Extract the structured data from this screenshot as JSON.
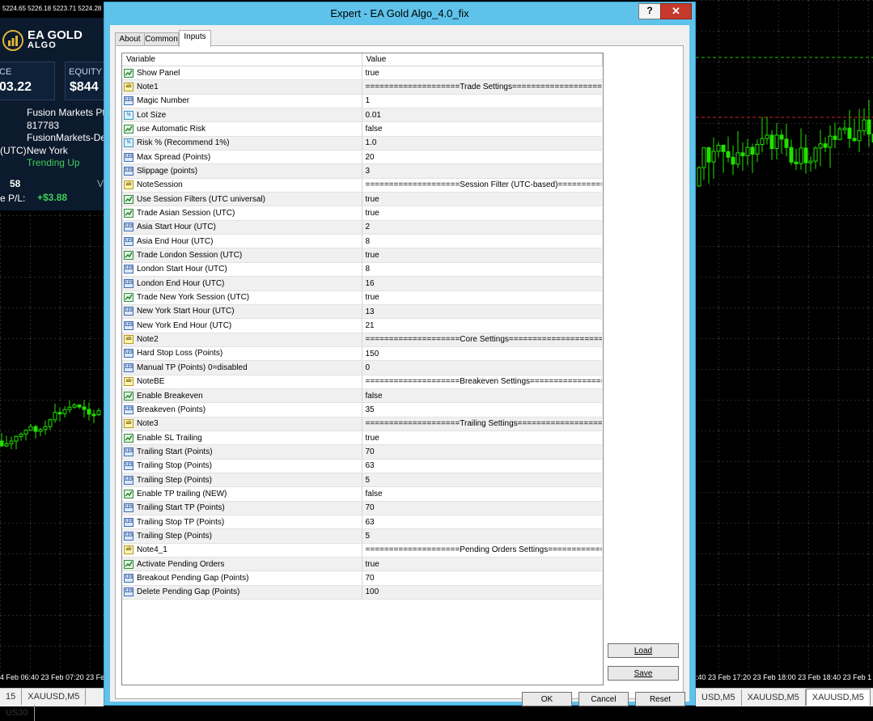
{
  "window": {
    "title": "Expert - EA Gold Algo_4.0_fix",
    "help_label": "?",
    "close_label": "✕"
  },
  "tabs": [
    {
      "label": "About"
    },
    {
      "label": "Common"
    },
    {
      "label": "Inputs"
    }
  ],
  "table": {
    "headers": {
      "variable": "Variable",
      "value": "Value"
    },
    "rows": [
      {
        "type": "bool",
        "name": "Show Panel",
        "value": "true"
      },
      {
        "type": "string",
        "name": "Note1",
        "value": "====================Trade Settings===================="
      },
      {
        "type": "int",
        "name": "Magic Number",
        "value": "1"
      },
      {
        "type": "double",
        "name": "Lot Size",
        "value": "0.01"
      },
      {
        "type": "bool",
        "name": "use Automatic Risk",
        "value": "false"
      },
      {
        "type": "double",
        "name": "Risk % (Recommend 1%)",
        "value": "1.0"
      },
      {
        "type": "int",
        "name": "Max Spread (Points)",
        "value": "20"
      },
      {
        "type": "int",
        "name": "Slippage (points)",
        "value": "3"
      },
      {
        "type": "string",
        "name": "NoteSession",
        "value": "====================Session Filter (UTC-based)==============..."
      },
      {
        "type": "bool",
        "name": "Use Session Filters (UTC universal)",
        "value": "true"
      },
      {
        "type": "bool",
        "name": "Trade Asian Session (UTC)",
        "value": "true"
      },
      {
        "type": "int",
        "name": "Asia Start Hour (UTC)",
        "value": "2"
      },
      {
        "type": "int",
        "name": "Asia End Hour (UTC)",
        "value": "8"
      },
      {
        "type": "bool",
        "name": "Trade London Session (UTC)",
        "value": "true"
      },
      {
        "type": "int",
        "name": "London Start Hour (UTC)",
        "value": "8"
      },
      {
        "type": "int",
        "name": "London End Hour (UTC)",
        "value": "16"
      },
      {
        "type": "bool",
        "name": "Trade New York Session (UTC)",
        "value": "true"
      },
      {
        "type": "int",
        "name": "New York Start Hour (UTC)",
        "value": "13"
      },
      {
        "type": "int",
        "name": "New York End Hour (UTC)",
        "value": "21"
      },
      {
        "type": "string",
        "name": "Note2",
        "value": "====================Core Settings===================="
      },
      {
        "type": "int",
        "name": "Hard Stop Loss (Points)",
        "value": "150"
      },
      {
        "type": "int",
        "name": "Manual TP (Points) 0=disabled",
        "value": "0"
      },
      {
        "type": "string",
        "name": "NoteBE",
        "value": "====================Breakeven Settings===================="
      },
      {
        "type": "bool",
        "name": "Enable Breakeven",
        "value": "false"
      },
      {
        "type": "int",
        "name": "Breakeven (Points)",
        "value": "35"
      },
      {
        "type": "string",
        "name": "Note3",
        "value": "====================Trailing Settings===================="
      },
      {
        "type": "bool",
        "name": "Enable SL Trailing",
        "value": "true"
      },
      {
        "type": "int",
        "name": "Trailing Start (Points)",
        "value": "70"
      },
      {
        "type": "int",
        "name": "Trailing Stop (Points)",
        "value": "63"
      },
      {
        "type": "int",
        "name": "Trailing Step (Points)",
        "value": "5"
      },
      {
        "type": "bool",
        "name": "Enable TP trailing (NEW)",
        "value": "false"
      },
      {
        "type": "int",
        "name": "Trailing Start TP (Points)",
        "value": "70"
      },
      {
        "type": "int",
        "name": "Trailing Stop TP (Points)",
        "value": "63"
      },
      {
        "type": "int",
        "name": "Trailing Step (Points)",
        "value": "5"
      },
      {
        "type": "string",
        "name": "Note4_1",
        "value": "====================Pending Orders Settings===============..."
      },
      {
        "type": "bool",
        "name": "Activate Pending Orders",
        "value": "true"
      },
      {
        "type": "int",
        "name": "Breakout Pending Gap (Points)",
        "value": "70"
      },
      {
        "type": "int",
        "name": "Delete Pending Gap (Points)",
        "value": "100"
      }
    ]
  },
  "buttons": {
    "load": "Load",
    "save": "Save",
    "ok": "OK",
    "cancel": "Cancel",
    "reset": "Reset"
  },
  "background": {
    "ticker": "5224.65 5226.18 5223.71 5224.28",
    "logo_line1": "EA GOLD",
    "logo_line2": "ALGO",
    "balance_caption": "CE",
    "balance_value": "03.22",
    "equity_caption": "EQUITY",
    "equity_value": "$844",
    "broker": "Fusion Markets Pt",
    "account": "817783",
    "server": "FusionMarkets-De",
    "session_label": "(UTC):",
    "session_value": "New York",
    "trend": "Trending Up",
    "count": "58",
    "count_right": "V",
    "pl_label": "e P/L:",
    "pl_value": "+$3.88",
    "left_time_axis": "4 Feb 06:40   23 Feb 07:20   23 Feb",
    "right_time_axis": ":40   23 Feb 17:20   23 Feb 18:00   23 Feb 18:40   23 Feb 1",
    "left_tabs": [
      "15",
      "XAUUSD,M5",
      "US30"
    ],
    "right_tabs": [
      "USD,M5",
      "XAUUSD,M5",
      "XAUUSD,M5"
    ],
    "up_color": "#22e000",
    "grid_color": "#505050"
  }
}
